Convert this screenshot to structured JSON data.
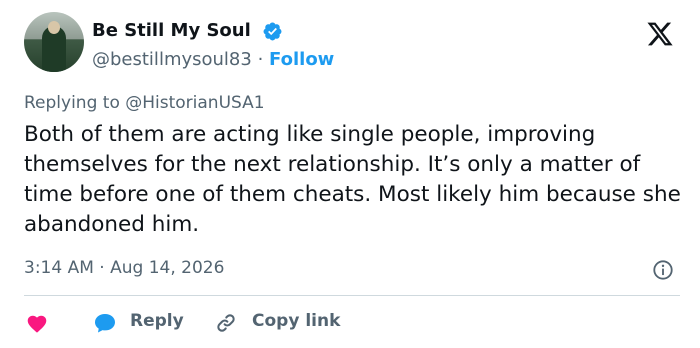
{
  "author": {
    "name": "Be Still My Soul",
    "handle": "@bestillmysoul83",
    "separator": "·",
    "follow_label": "Follow"
  },
  "reply_context": {
    "prefix": "Replying to",
    "mention": "@HistorianUSA1"
  },
  "tweet": {
    "text": "Both of them are acting like single people, improving themselves for the next relationship. It’s only a matter of time before one of them cheats. Most likely him because she abandoned him.",
    "time": "3:14 AM",
    "separator": "·",
    "date": "Aug 14, 2026"
  },
  "actions": {
    "reply_label": "Reply",
    "copy_link_label": "Copy link"
  },
  "icons": {
    "verified": "verified-badge-icon",
    "logo": "x-logo-icon",
    "info": "info-icon",
    "like": "heart-icon",
    "reply": "reply-bubble-icon",
    "link": "link-icon"
  },
  "colors": {
    "accent": "#1d9bf0",
    "heart": "#f91880",
    "secondary_text": "#536471",
    "primary_text": "#0f1419",
    "divider": "#cfd9de"
  }
}
